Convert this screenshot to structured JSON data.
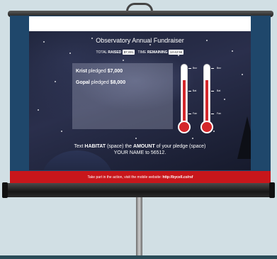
{
  "screen": {
    "title": "Observatory Annual Fundraiser",
    "stats": {
      "total_prefix": "TOTAL",
      "total_keyword": "RAISED",
      "total_value": "$7,001",
      "time_prefix": "TIME",
      "time_keyword": "REMAINING",
      "time_value": "13:42:56"
    },
    "pledges": [
      {
        "name": "Krist",
        "verb": "pledged",
        "amount": "$7,000"
      },
      {
        "name": "Gopal",
        "verb": "pledged",
        "amount": "$8,000"
      }
    ],
    "thermometers": [
      {
        "marks": [
          "Bez",
          "Bat",
          "Fan"
        ],
        "fill_percent": 85,
        "fill_color": "#d4272b"
      },
      {
        "marks": [
          "Bez",
          "Bat",
          "Fan"
        ],
        "fill_percent": 85,
        "fill_color": "#d4272b"
      }
    ],
    "instruction": {
      "text_part1": "Text",
      "keyword_habitat": "HABITAT",
      "text_part2": "(space) the",
      "keyword_amount": "AMOUNT",
      "text_part3": "of your pledge (space)",
      "line2": "YOUR NAME to 56512."
    },
    "footer": {
      "prefix": "Take part in the action, visit the mobile website:",
      "link": "http://bycell.co/rsf"
    }
  },
  "colors": {
    "accent_red": "#c8161b",
    "frame_blue": "#1f476b",
    "background": "#d1dfe4"
  }
}
